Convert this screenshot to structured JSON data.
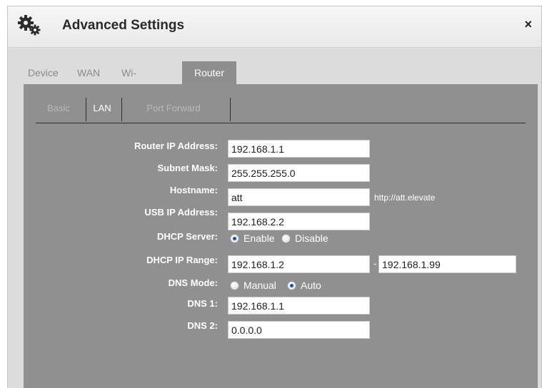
{
  "window": {
    "title": "Advanced Settings",
    "close_label": "×",
    "icon": "gears-icon"
  },
  "tabs": [
    {
      "label": "Device",
      "active": false
    },
    {
      "label": "WAN",
      "active": false
    },
    {
      "label": "Wi-Fi",
      "active": false
    },
    {
      "label": "Router",
      "active": true
    }
  ],
  "subtabs": [
    {
      "label": "Basic",
      "active": false
    },
    {
      "label": "LAN",
      "active": true
    },
    {
      "label": "Port Forward",
      "active": false
    }
  ],
  "form": {
    "router_ip": {
      "label": "Router IP Address:",
      "value": "192.168.1.1"
    },
    "subnet_mask": {
      "label": "Subnet Mask:",
      "value": "255.255.255.0"
    },
    "hostname": {
      "label": "Hostname:",
      "value": "att",
      "hint": "http://att.elevate"
    },
    "usb_ip": {
      "label": "USB IP Address:",
      "value": "192.168.2.2"
    },
    "dhcp_server": {
      "label": "DHCP Server:",
      "options": [
        "Enable",
        "Disable"
      ],
      "selected": "Enable"
    },
    "dhcp_range": {
      "label": "DHCP IP Range:",
      "start": "192.168.1.2",
      "separator": "-",
      "end": "192.168.1.99"
    },
    "dns_mode": {
      "label": "DNS Mode:",
      "options": [
        "Manual",
        "Auto"
      ],
      "selected": "Auto"
    },
    "dns1": {
      "label": "DNS 1:",
      "value": "192.168.1.1"
    },
    "dns2": {
      "label": "DNS 2:",
      "value": "0.0.0.0"
    }
  },
  "colors": {
    "panel": "#909090",
    "radio_selected": "#1a4fb4"
  }
}
